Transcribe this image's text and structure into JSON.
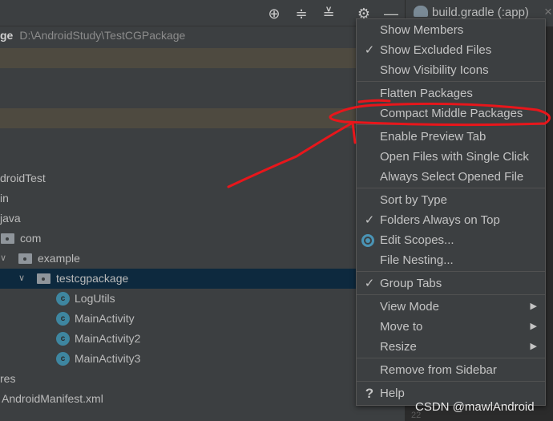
{
  "toolbar": {
    "icons": [
      "locate-icon",
      "expand-all-icon",
      "collapse-all-icon",
      "gear-icon",
      "minimize-icon"
    ]
  },
  "editor_tab": {
    "title": "build.gradle (:app)",
    "icon": "gradle-elephant-icon",
    "close": "×"
  },
  "project_header": {
    "name_fragment": "ge",
    "path": "D:\\AndroidStudy\\TestCGPackage"
  },
  "tree": [
    {
      "label": "droidTest"
    },
    {
      "label": "in"
    },
    {
      "label": "java"
    },
    {
      "label": "com",
      "icon": "package-folder-icon"
    },
    {
      "label": "example",
      "icon": "package-folder-icon",
      "expanded": true
    },
    {
      "label": "testcgpackage",
      "icon": "package-folder-icon",
      "expanded": true,
      "selected": true
    },
    {
      "label": "LogUtils",
      "icon": "class-icon"
    },
    {
      "label": "MainActivity",
      "icon": "class-icon"
    },
    {
      "label": "MainActivity2",
      "icon": "class-icon"
    },
    {
      "label": "MainActivity3",
      "icon": "class-icon"
    },
    {
      "label": "res"
    },
    {
      "label": "AndroidManifest.xml"
    }
  ],
  "menu": {
    "items": [
      {
        "label": "Show Members"
      },
      {
        "label": "Show Excluded Files",
        "checked": true
      },
      {
        "label": "Show Visibility Icons"
      },
      {
        "label": "Flatten Packages"
      },
      {
        "label": "Compact Middle Packages"
      },
      {
        "label": "Enable Preview Tab"
      },
      {
        "label": "Open Files with Single Click"
      },
      {
        "label": "Always Select Opened File"
      },
      {
        "label": "Sort by Type"
      },
      {
        "label": "Folders Always on Top",
        "checked": true
      },
      {
        "label": "Edit Scopes...",
        "radio": true
      },
      {
        "label": "File Nesting..."
      },
      {
        "label": "Group Tabs",
        "checked": true
      },
      {
        "label": "View Mode",
        "submenu": true
      },
      {
        "label": "Move to",
        "submenu": true
      },
      {
        "label": "Resize",
        "submenu": true
      },
      {
        "label": "Remove from Sidebar"
      },
      {
        "label": "Help",
        "icon": "help-icon"
      }
    ],
    "check_glyph": "✓",
    "arrow_glyph": "▶",
    "help_glyph": "?"
  },
  "watermark": "CSDN @mawlAndroid",
  "gutter_line": "22",
  "annotation_color": "#e8161b"
}
